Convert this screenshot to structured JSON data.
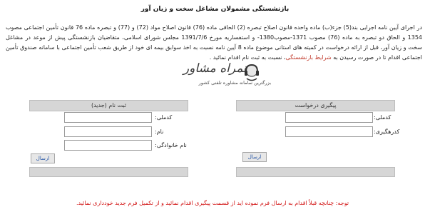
{
  "page": {
    "title": "بازنشستگی مشمولان مشاغل سخت و زیان آور",
    "paragraph_before_link": "در اجرای آیین نامه اجرایی بند(5) جزء(ب) ماده واحده قانون اصلاح تبصره (2) الحاقی ماده (76) قانون اصلاح مواد (72) و (77) و تبصره ماده 76 قانون تأمین اجتماعی مصوب 1354 و الحاق دو تبصره به ماده (76) مصوب 1371-مصوب1380- و استفساریه مورخ 1391/7/6 مجلس شورای اسلامی، متقاضیان بازنشستگی پیش از موعد در مشاغل سخت و زیان آور، قبل از ارائه درخواست در کمیته های استانی موضوع ماده 8 آیین نامه نسبت به اخذ سوابق بیمه ای خود از طریق شعب تأمین اجتماعی با سامانه صندوق تأمین اجتماعی اقدام تا در صورت رسیدن به",
    "link_text": "شرایط بازنشستگی",
    "paragraph_after_link": "، نسبت به ثبت نام اقدام نمائید .",
    "note": "توجه: چنانچه قبلاً اقدام به ارسال فرم نموده اید از قسمت پیگیری اقدام نمائید و از تکمیل فرم جدید خودداری نمائید."
  },
  "watermark": {
    "brand": "همراه مشاور",
    "slogan": "بزرگترین سامانه مشاوره تلفنی کشور"
  },
  "register_panel": {
    "header": "ثبت نام (جدید)",
    "fields": [
      {
        "label": "کدملی:",
        "value": ""
      },
      {
        "label": "نام:",
        "value": ""
      },
      {
        "label": "نام خانوادگی:",
        "value": ""
      }
    ],
    "submit_label": "ارسال"
  },
  "followup_panel": {
    "header": "پیگیری درخواست",
    "fields": [
      {
        "label": "کدملی:",
        "value": ""
      },
      {
        "label": "کدرهگیری:",
        "value": ""
      }
    ],
    "submit_label": "ارسال"
  },
  "colors": {
    "panel_header_bg": "#d6d6d6",
    "note_red": "#d31919",
    "link_red": "#c0392b"
  }
}
